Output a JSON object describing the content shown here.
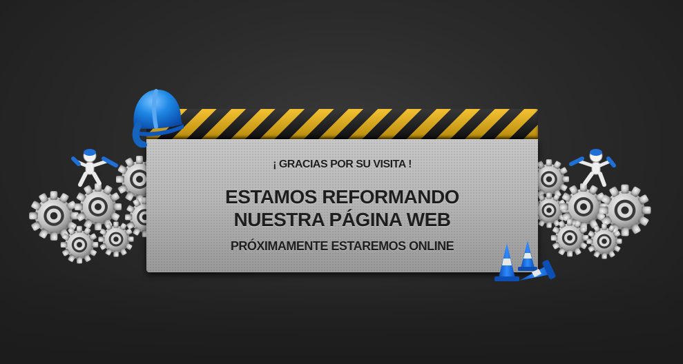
{
  "sign": {
    "line1": "¡ GRACIAS POR SU VISITA !",
    "line2": "ESTAMOS REFORMANDO",
    "line3": "NUESTRA PÁGINA WEB",
    "line4": "PRÓXIMAMENTE ESTAREMOS ONLINE"
  },
  "colors": {
    "background": "#2a2a2a",
    "stripe_yellow": "#f2b70f",
    "stripe_black": "#151515",
    "plate": "#b8b8b8",
    "helmet": "#1e88e5",
    "cone": "#1565d8"
  },
  "icons": {
    "helmet": "hard-hat-icon",
    "gears": "gear-icon",
    "worker": "worker-figure-icon",
    "cones": "traffic-cone-icon"
  }
}
